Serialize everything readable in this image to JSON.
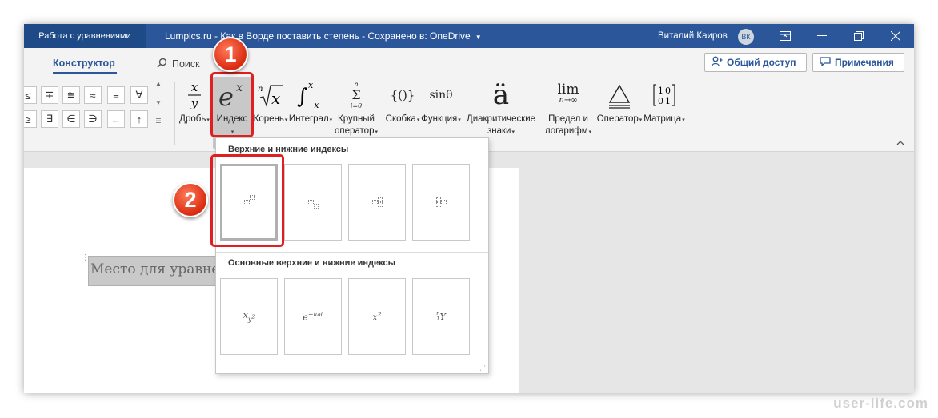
{
  "titlebar": {
    "context_tab": "Работа с уравнениями",
    "doc_title": "Lumpics.ru - Как в Ворде поставить степень - Сохранено в: OneDrive",
    "user_name": "Виталий Каиров",
    "user_initials": "ВК"
  },
  "tabs": {
    "active": "Конструктор",
    "search": "Поиск",
    "share": "Общий доступ",
    "comments": "Примечания"
  },
  "symbols": [
    "≤",
    "∓",
    "≅",
    "≈",
    "≡",
    "∀",
    "≥",
    "∃",
    "∈",
    "∋",
    "←",
    "↑"
  ],
  "ribbon": {
    "fraction": "Дробь",
    "index": "Индекс",
    "radical": "Корень",
    "integral": "Интеграл",
    "large_operator_1": "Крупный",
    "large_operator_2": "оператор",
    "bracket": "Скобка",
    "function": "Функция",
    "accent_1": "Диакритические",
    "accent_2": "знаки",
    "limit_1": "Предел и",
    "limit_2": "логарифм",
    "operator": "Оператор",
    "matrix": "Матрица",
    "function_icon": "sinθ",
    "limit_icon_top": "lim",
    "limit_icon_bottom": "n→∞",
    "accent_icon": "ä",
    "bracket_icon": "{()}",
    "sum_top": "n",
    "sum_bottom": "i=0"
  },
  "document": {
    "equation_placeholder": "Место для уравнения."
  },
  "gallery": {
    "section1_title": "Верхние и нижние индексы",
    "section2_title": "Основные верхние и нижние индексы",
    "common": [
      {
        "base": "x",
        "sub": "y",
        "sup": "2"
      },
      {
        "base": "e",
        "sup": "−iωt"
      },
      {
        "base": "x",
        "sup": "2"
      },
      {
        "pre_sup": "n",
        "pre_sub": "1",
        "base": "Y"
      }
    ]
  },
  "annotations": {
    "step1": "1",
    "step2": "2"
  },
  "watermark": "user-life.com",
  "colors": {
    "accent": "#2b579a",
    "highlight": "#e02020",
    "context_tab": "#1e4a87"
  }
}
